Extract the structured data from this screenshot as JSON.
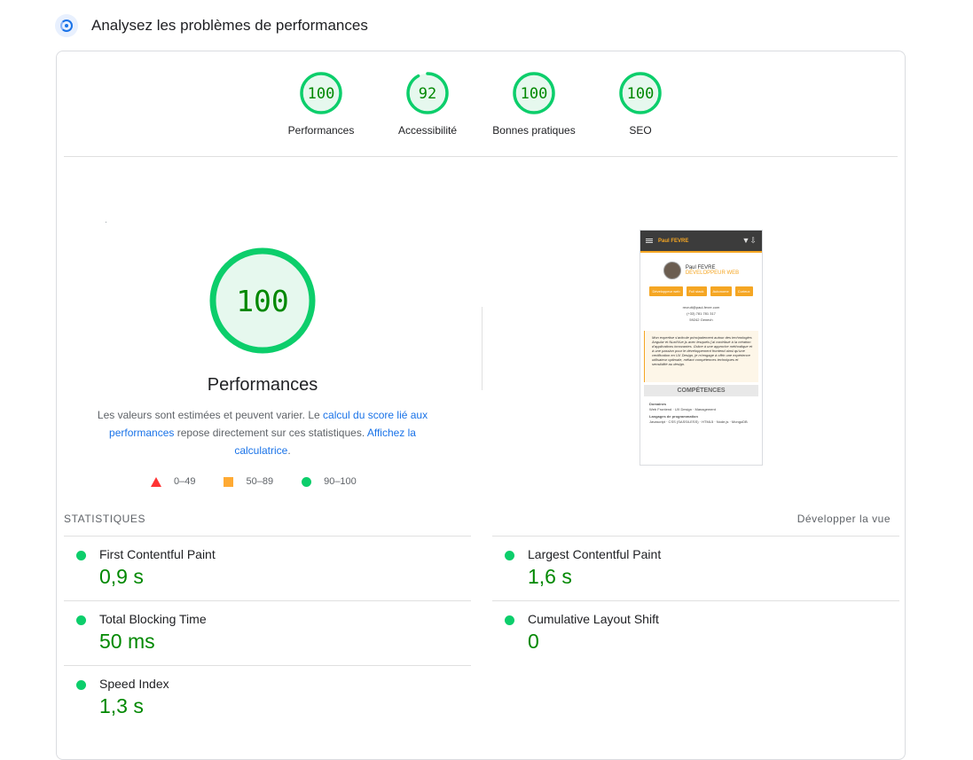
{
  "header": {
    "title": "Analysez les problèmes de performances",
    "icon": "lighthouse-gauge-icon"
  },
  "gauges": [
    {
      "score": 100,
      "label": "Performances"
    },
    {
      "score": 92,
      "label": "Accessibilité"
    },
    {
      "score": 100,
      "label": "Bonnes pratiques"
    },
    {
      "score": 100,
      "label": "SEO"
    }
  ],
  "performance": {
    "score": 100,
    "title": "Performances",
    "desc_pre": "Les valeurs sont estimées et peuvent varier. Le ",
    "desc_link1": "calcul du score lié aux performances",
    "desc_mid": " repose directement sur ces statistiques. ",
    "desc_link2": "Affichez la calculatrice",
    "desc_end": "."
  },
  "legend": {
    "fail": "0–49",
    "average": "50–89",
    "pass": "90–100"
  },
  "colors": {
    "pass": "#0cce6b",
    "pass_text": "#008800",
    "average": "#ffaa33",
    "fail": "#ff3333",
    "link": "#1a73e8",
    "accent": "#f5a623"
  },
  "screenshot": {
    "name": "Paul FEVRE",
    "person": "Paul FEVRE",
    "role": "DÉVELOPPEUR WEB",
    "tags": [
      "Développeur web",
      "Full stack",
      "Autonome",
      "Curieux"
    ],
    "email": "recruit@paul-fevre.com",
    "phone": "(+33) 781 781 317",
    "location": "59242 Genech",
    "bio": "Mon expertise s'articule principalement autour des technologies Angular et Nuxt/Vue.js avec lesquels j'ai contribué à la création d'applications innovantes. Grâce à une approche méthodique et à une passion pour le développement frontend ainsi qu'une certification en UX Design, je m'engage à offrir une expérience utilisateur optimale, mêlant compétences techniques et sensibilité au design.",
    "section": "COMPÉTENCES",
    "domains_title": "Domaines",
    "domains": "Web Frontend · UX Design · Management",
    "langs_title": "Langages de programmation",
    "langs": "Javascript · CSS (SASS/LESS) · HTML5 · Node.js · MongoDB"
  },
  "stats": {
    "title": "STATISTIQUES",
    "expand": "Développer la vue",
    "metrics": [
      {
        "name": "First Contentful Paint",
        "value": "0,9 s"
      },
      {
        "name": "Largest Contentful Paint",
        "value": "1,6 s"
      },
      {
        "name": "Total Blocking Time",
        "value": "50 ms"
      },
      {
        "name": "Cumulative Layout Shift",
        "value": "0"
      },
      {
        "name": "Speed Index",
        "value": "1,3 s"
      }
    ]
  }
}
